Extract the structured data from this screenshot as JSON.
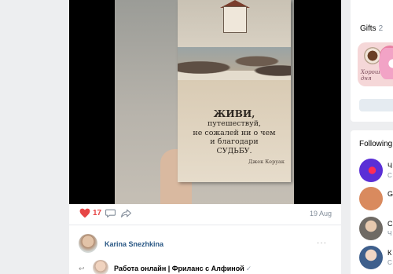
{
  "post": {
    "photo_quote": {
      "line1": "ЖИВИ,",
      "line2": "путешествуй,",
      "line3": "не сожалей ни о чем",
      "line4": "и благодари",
      "line5": "СУДЬБУ.",
      "author": "Джек Керуак"
    },
    "likes": "17",
    "date": "19 Aug"
  },
  "comment": {
    "author": "Karina Snezhkina",
    "more": "···"
  },
  "repost": {
    "arrow": "↩",
    "group_name": "Работа онлайн | Фриланс с Алфиной",
    "verified": "✓"
  },
  "gifts": {
    "title": "Gifts",
    "count": "2",
    "card_text_line1": "Хорошего",
    "card_text_line2": "дня"
  },
  "following": {
    "title": "Following",
    "items": [
      {
        "name": "Ч",
        "sub": "С",
        "avatar_color": "#5a2fd6",
        "badge": "БР"
      },
      {
        "name": "G",
        "sub": "",
        "avatar_color": "#d98a5e",
        "badge": "GF"
      },
      {
        "name": "С",
        "sub": "Ч",
        "avatar_color": "#6f6a64",
        "badge": ""
      },
      {
        "name": "К",
        "sub": "С",
        "avatar_color": "#3e5f8c",
        "badge": ""
      }
    ]
  },
  "colors": {
    "link": "#2a5885",
    "like": "#e64646",
    "muted": "#818c99",
    "page_bg": "#edeef0"
  }
}
